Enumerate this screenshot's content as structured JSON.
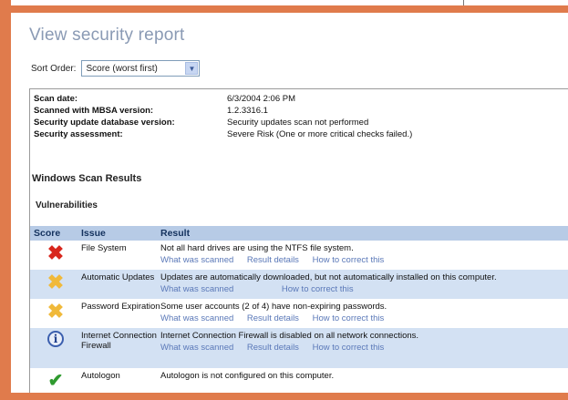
{
  "window": {
    "title": "View security report"
  },
  "sort": {
    "label": "Sort Order:",
    "value": "Score (worst first)"
  },
  "meta": [
    {
      "key": "Scan date:",
      "value": "6/3/2004 2:06 PM"
    },
    {
      "key": "Scanned with MBSA version:",
      "value": "1.2.3316.1"
    },
    {
      "key": "Security update database version:",
      "value": "Security updates scan not performed"
    },
    {
      "key": "Security assessment:",
      "value": "Severe Risk (One or more critical checks failed.)"
    }
  ],
  "section": {
    "title": "Windows Scan Results",
    "subtitle": "Vulnerabilities"
  },
  "table": {
    "headers": {
      "score": "Score",
      "issue": "Issue",
      "result": "Result"
    },
    "rows": [
      {
        "icon": "red-x-icon",
        "issue": "File System",
        "result": "Not all hard drives are using the NTFS file system.",
        "links": [
          "What was scanned",
          "Result details",
          "How to correct this"
        ]
      },
      {
        "icon": "yellow-x-icon",
        "issue": "Automatic Updates",
        "result": "Updates are automatically downloaded, but not automatically installed on this computer.",
        "links": [
          "What was scanned",
          "How to correct this"
        ]
      },
      {
        "icon": "yellow-x-icon",
        "issue": "Password Expiration",
        "result": "Some user accounts (2 of 4) have non-expiring passwords.",
        "links": [
          "What was scanned",
          "Result details",
          "How to correct this"
        ]
      },
      {
        "icon": "info-icon",
        "issue": "Internet Connection Firewall",
        "result": "Internet Connection Firewall is disabled on all network connections.",
        "links": [
          "What was scanned",
          "Result details",
          "How to correct this"
        ]
      },
      {
        "icon": "green-check-icon",
        "issue": "Autologon",
        "result": "Autologon is not configured on this computer.",
        "links": []
      }
    ]
  },
  "colors": {
    "frame": "#e07b4c",
    "header": "#b7cbe6",
    "row_alt": "#d3e1f3",
    "link": "#5a78b8"
  }
}
